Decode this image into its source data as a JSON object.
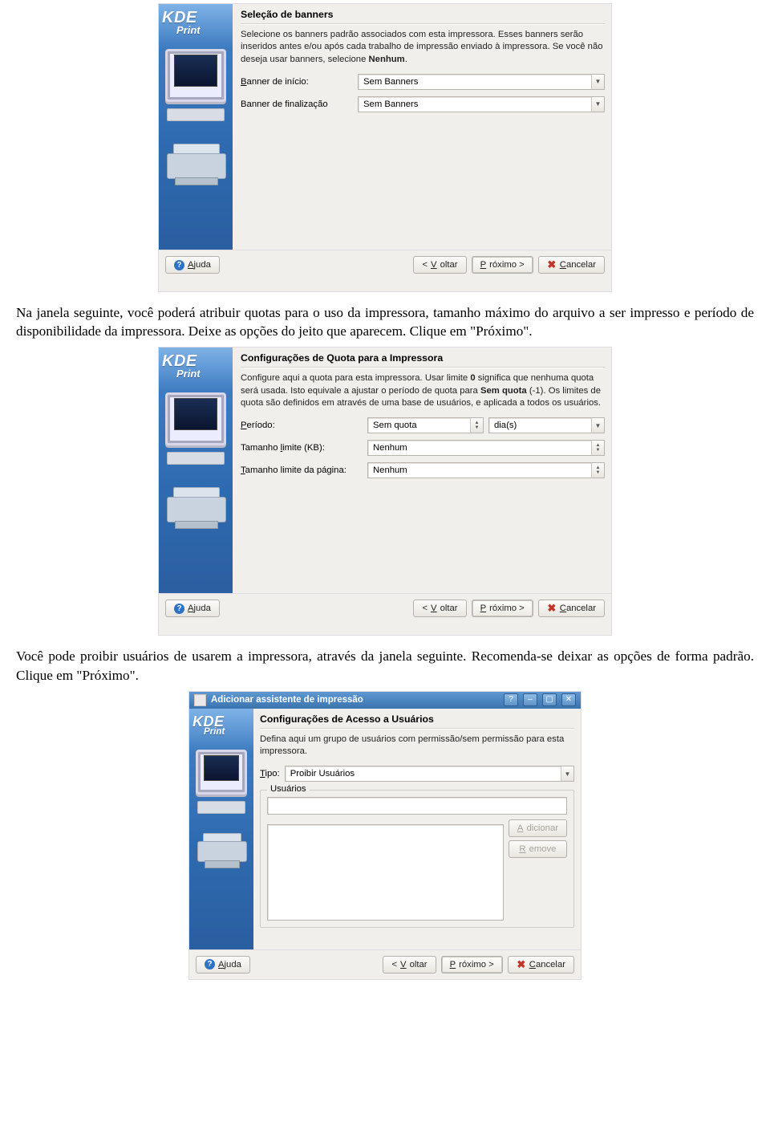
{
  "dialog1": {
    "heading": "Seleção de banners",
    "desc_1": "Selecione os banners padrão associados com esta impressora. Esses banners serão inseridos antes e/ou após cada trabalho de impressão enviado à impressora. Se você não deseja usar banners, selecione ",
    "desc_bold": "Nenhum",
    "desc_2": ".",
    "row1_label_pre": "B",
    "row1_label_post": "anner de início:",
    "row1_value": "Sem Banners",
    "row2_label": "Banner de finalização",
    "row2_value": "Sem Banners",
    "help_u": "A",
    "help_rest": "juda",
    "back_pre": "< ",
    "back_u": "V",
    "back_post": "oltar",
    "next_u": "P",
    "next_post": "róximo >",
    "cancel_u": "C",
    "cancel_post": "ancelar"
  },
  "para1": "Na janela seguinte, você poderá atribuir quotas para o uso da impressora, tamanho máximo do arquivo a ser impresso e período de disponibilidade da impressora. Deixe as opções do jeito que aparecem. Clique em \"Próximo\".",
  "dialog2": {
    "heading": "Configurações de Quota para a Impressora",
    "desc_1": "Configure aqui a quota para esta impressora. Usar limite ",
    "desc_b1": "0",
    "desc_2": " significa que nenhuma quota será usada. Isto equivale a ajustar o período de quota para ",
    "desc_b2": "Sem quota",
    "desc_3": " (-1). Os limites de quota são definidos em através de uma base de usuários, e aplicada a todos os usuários.",
    "row1_u": "P",
    "row1_post": "eríodo:",
    "row1_value": "Sem quota",
    "row1_unit": "dia(s)",
    "row2_pre": "Tamanho ",
    "row2_u": "l",
    "row2_post": "imite (KB):",
    "row2_value": "Nenhum",
    "row3_u": "T",
    "row3_post": "amanho limite da página:",
    "row3_value": "Nenhum",
    "help_u": "A",
    "help_rest": "juda",
    "back_pre": "< ",
    "back_u": "V",
    "back_post": "oltar",
    "next_u": "P",
    "next_post": "róximo >",
    "cancel_u": "C",
    "cancel_post": "ancelar"
  },
  "para2": "Você pode proibir usuários de usarem a impressora, através da janela seguinte. Recomenda-se deixar as opções de forma padrão. Clique em \"Próximo\".",
  "dialog3": {
    "title": "Adicionar assistente de impressão",
    "heading": "Configurações de Acesso a Usuários",
    "desc": "Defina aqui um grupo de usuários com permissão/sem permissão para esta impressora.",
    "type_u": "T",
    "type_post": "ipo:",
    "type_value": "Proibir Usuários",
    "group_title": "Usuários",
    "add_u": "A",
    "add_post": "dicionar",
    "rem_u": "R",
    "rem_post": "emove",
    "help_u": "A",
    "help_rest": "juda",
    "back_pre": "< ",
    "back_u": "V",
    "back_post": "oltar",
    "next_u": "P",
    "next_post": "róximo >",
    "cancel_u": "C",
    "cancel_post": "ancelar"
  },
  "sidebar": {
    "k": "KDE",
    "sub": "Print"
  }
}
